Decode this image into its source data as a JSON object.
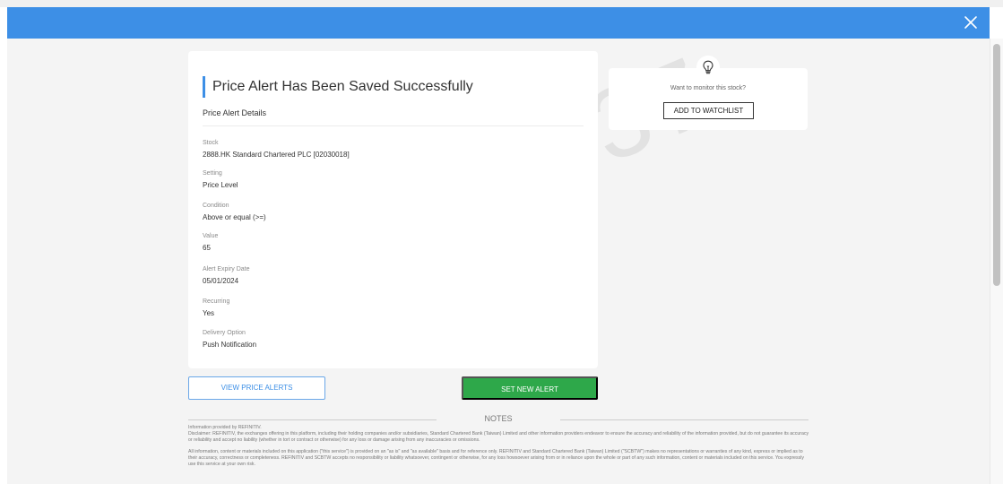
{
  "close_icon": "close-icon",
  "watermark": "2012937",
  "alert_card": {
    "title": "Price Alert Has Been Saved Successfully",
    "subtitle": "Price Alert Details",
    "fields": [
      {
        "label": "Stock",
        "value": "2888.HK Standard Chartered PLC [02030018]"
      },
      {
        "label": "Setting",
        "value": "Price Level"
      },
      {
        "label": "Condition",
        "value": "Above or equal (>=)"
      },
      {
        "label": "Value",
        "value": "65"
      },
      {
        "label": "Alert Expiry Date",
        "value": "05/01/2024"
      },
      {
        "label": "Recurring",
        "value": "Yes"
      },
      {
        "label": "Delivery Option",
        "value": "Push Notification"
      }
    ]
  },
  "watchlist": {
    "icon": "lightbulb-icon",
    "prompt": "Want to monitor this stock?",
    "button_label": "ADD TO WATCHLIST"
  },
  "actions": {
    "view_label": "VIEW PRICE ALERTS",
    "set_label": "SET NEW ALERT"
  },
  "notes": {
    "title": "NOTES",
    "line1": "Information provided by REFINITIV.",
    "line2": "Disclaimer: REFINITIV, the exchanges offering in this platform, including their holding companies and/or subsidiaries, Standard Chartered Bank (Taiwan) Limited and other information providers endeavor to ensure the accuracy and reliability of the information provided, but do not guarantee its accuracy or reliability and accept no liability (whether in tort or contract or otherwise) for any loss or damage arising from any inaccuracies or omissions.",
    "line3": "All information, content or materials included on this application (\"this service\") is provided on an \"as is\" and \"as available\" basis and for reference only. REFINITIV and Standard Chartered Bank (Taiwan) Limited (\"SCBTW\") makes no representations or warranties of any kind, express or implied as to their accuracy, correctness or completeness. REFINITIV and SCBTW accepts no responsibility or liability whatsoever, contingent or otherwise, for any loss howsoever arising from or in reliance upon the whole or part of any such information, content or materials included on this service. You expressly use this service at your own risk."
  },
  "colors": {
    "header": "#3d8fe6",
    "primary_button": "#2ea84a",
    "accent": "#3d8fe6"
  }
}
